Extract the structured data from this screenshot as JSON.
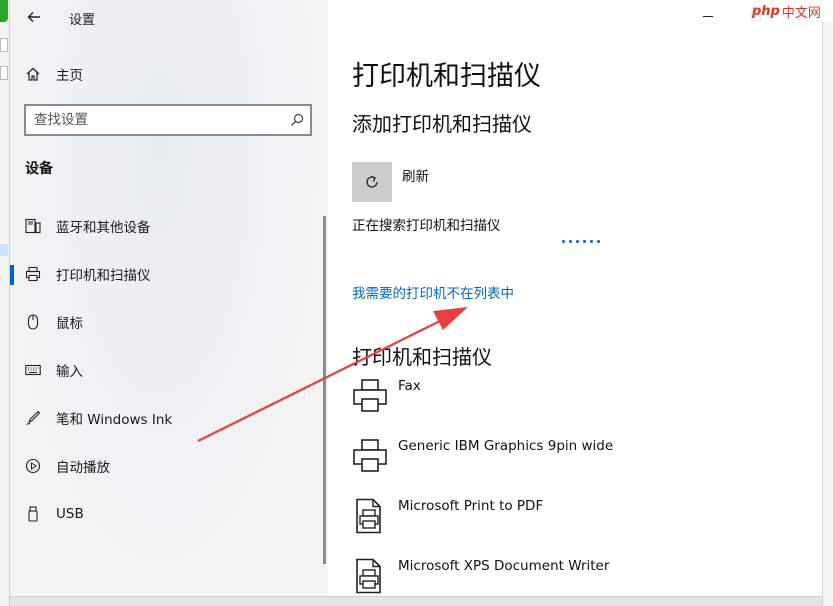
{
  "window": {
    "title": "设置"
  },
  "sidebar": {
    "home_label": "主页",
    "search_placeholder": "查找设置",
    "section_title": "设备",
    "items": [
      {
        "label": "蓝牙和其他设备",
        "icon": "devices-icon",
        "active": false
      },
      {
        "label": "打印机和扫描仪",
        "icon": "printer-icon",
        "active": true
      },
      {
        "label": "鼠标",
        "icon": "mouse-icon",
        "active": false
      },
      {
        "label": "输入",
        "icon": "keyboard-icon",
        "active": false
      },
      {
        "label": "笔和 Windows Ink",
        "icon": "pen-icon",
        "active": false
      },
      {
        "label": "自动播放",
        "icon": "autoplay-icon",
        "active": false
      },
      {
        "label": "USB",
        "icon": "usb-icon",
        "active": false
      }
    ]
  },
  "main": {
    "page_title": "打印机和扫描仪",
    "add_heading": "添加打印机和扫描仪",
    "refresh_label": "刷新",
    "searching_text": "正在搜索打印机和扫描仪",
    "not_listed_link": "我需要的打印机不在列表中",
    "list_heading": "打印机和扫描仪",
    "printers": [
      {
        "name": "Fax",
        "icon": "printer-icon"
      },
      {
        "name": "Generic IBM Graphics 9pin wide",
        "icon": "printer-icon"
      },
      {
        "name": "Microsoft Print to PDF",
        "icon": "document-printer-icon"
      },
      {
        "name": "Microsoft XPS Document Writer",
        "icon": "document-printer-icon"
      }
    ]
  },
  "watermark": {
    "brand": "php",
    "site": "中文网"
  },
  "colors": {
    "accent": "#0067c0",
    "annotation_arrow": "#e8403a"
  }
}
